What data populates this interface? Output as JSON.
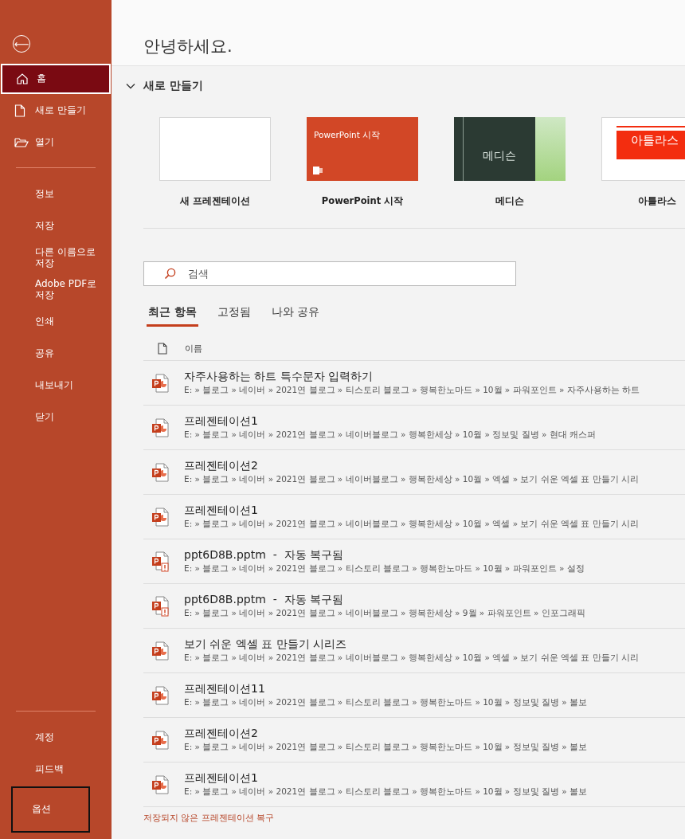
{
  "sidebar": {
    "back_button": "⟵",
    "items": [
      {
        "label": "홈",
        "kind": "home",
        "selected": true,
        "focused": false
      },
      {
        "label": "새로 만들기",
        "kind": "file",
        "selected": false,
        "focused": false
      },
      {
        "label": "열기",
        "kind": "folder",
        "selected": false,
        "focused": false
      },
      {
        "kind": "divider"
      },
      {
        "label": "정보",
        "selected": false,
        "focused": false
      },
      {
        "label": "저장",
        "selected": false,
        "focused": false
      },
      {
        "label": "다른 이름으로 저장",
        "selected": false,
        "focused": false
      },
      {
        "label": "Adobe PDF로 저장",
        "selected": false,
        "focused": false
      },
      {
        "label": "인쇄",
        "selected": false,
        "focused": false
      },
      {
        "label": "공유",
        "selected": false,
        "focused": false
      },
      {
        "label": "내보내기",
        "selected": false,
        "focused": false
      },
      {
        "label": "닫기",
        "selected": false,
        "focused": false
      }
    ],
    "bottom_items": [
      {
        "kind": "divider"
      },
      {
        "label": "계정",
        "selected": false,
        "focused": false
      },
      {
        "label": "피드백",
        "selected": false,
        "focused": false
      },
      {
        "label": "옵션",
        "selected": false,
        "focused": true
      }
    ]
  },
  "greeting": "안녕하세요.",
  "new_section": {
    "title": "새로 만들기",
    "expanded": true,
    "templates": [
      {
        "kind": "blank",
        "label": "새 프레젠테이션"
      },
      {
        "kind": "start",
        "label": "PowerPoint 시작",
        "thumb_text": "PowerPoint 시작"
      },
      {
        "kind": "medicine",
        "label": "메디슨",
        "thumb_text": "메디슨"
      },
      {
        "kind": "atlas",
        "label": "아틀라스",
        "thumb_text": "아틀라스"
      }
    ]
  },
  "search": {
    "placeholder": "검색"
  },
  "tabs": [
    {
      "label": "최근 항목",
      "selected": true
    },
    {
      "label": "고정됨",
      "selected": false
    },
    {
      "label": "나와 공유",
      "selected": false
    }
  ],
  "table": {
    "columns": [
      "이름"
    ],
    "rows": [
      {
        "kind": "pptx",
        "name": "자주사용하는 하트 특수문자 입력하기",
        "path": "E: » 블로그 » 네이버 » 2021연 블로그 » 티스토리 블로그 » 행복한노마드 » 10월 » 파워포인트 » 자주사용하는 하트"
      },
      {
        "kind": "pptx",
        "name": "프레젠테이션1",
        "path": "E: » 블로그 » 네이버 » 2021연 블로그 » 네이버블로그 » 행복한세상 » 10월 » 정보및 질병 » 현대 캐스퍼"
      },
      {
        "kind": "pptx",
        "name": "프레젠테이션2",
        "path": "E: » 블로그 » 네이버 » 2021연 블로그 » 네이버블로그 » 행복한세상 » 10월 » 엑셀 » 보기 쉬운 엑셀 표 만들기 시리"
      },
      {
        "kind": "pptx",
        "name": "프레젠테이션1",
        "path": "E: » 블로그 » 네이버 » 2021연 블로그 » 네이버블로그 » 행복한세상 » 10월 » 엑셀 » 보기 쉬운 엑셀 표 만들기 시리"
      },
      {
        "kind": "recovered",
        "name": "ppt6D8B.pptm  -  자동 복구됨",
        "path": "E: » 블로그 » 네이버 » 2021연 블로그 » 티스토리 블로그 » 행복한노마드 » 10월 » 파워포인트 » 설정"
      },
      {
        "kind": "recovered",
        "name": "ppt6D8B.pptm  -  자동 복구됨",
        "path": "E: » 블로그 » 네이버 » 2021연 블로그 » 네이버블로그 » 행복한세상 » 9월 » 파워포인트 » 인포그래픽"
      },
      {
        "kind": "pptx",
        "name": "보기 쉬운 엑셀 표 만들기 시리즈",
        "path": "E: » 블로그 » 네이버 » 2021연 블로그 » 네이버블로그 » 행복한세상 » 10월 » 엑셀 » 보기 쉬운 엑셀 표 만들기 시리"
      },
      {
        "kind": "pptx",
        "name": "프레젠테이션11",
        "path": "E: » 블로그 » 네이버 » 2021연 블로그 » 티스토리 블로그 » 행복한노마드 » 10월 » 정보및 질병 » 볼보"
      },
      {
        "kind": "pptx",
        "name": "프레젠테이션2",
        "path": "E: » 블로그 » 네이버 » 2021연 블로그 » 티스토리 블로그 » 행복한노마드 » 10월 » 정보및 질병 » 볼보"
      },
      {
        "kind": "pptx",
        "name": "프레젠테이션1",
        "path": "E: » 블로그 » 네이버 » 2021연 블로그 » 티스토리 블로그 » 행복한노마드 » 10월 » 정보및 질병 » 볼보"
      }
    ]
  },
  "recover_link": "저장되지 않은 프레젠테이션 복구"
}
